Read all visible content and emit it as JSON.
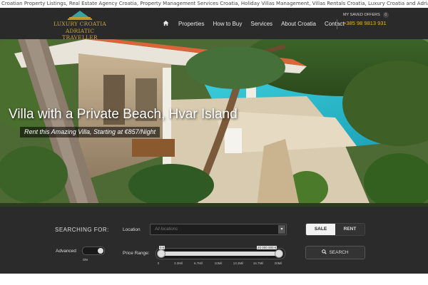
{
  "seo_text": "Croatian Property Listings, Real Estate Agency Croatia, Property Management Services Croatia, Holiday Villas Management, Villas Rentals Croatia, Luxury Croatia and Adriatic Traveller,",
  "logo": {
    "line1": "LUXURY CROATIA",
    "line2": "ADRIATIC TRAVELLER"
  },
  "nav": {
    "home_icon": "home-icon",
    "items": [
      {
        "label": "Properties"
      },
      {
        "label": "How to Buy"
      },
      {
        "label": "Services"
      },
      {
        "label": "About Croatia"
      },
      {
        "label": "Contact"
      }
    ]
  },
  "header_right": {
    "saved_label": "MY SAVED OFFERS",
    "saved_count": "0",
    "phone": "+385 98 9813 931"
  },
  "hero": {
    "title": "Villa with a Private Beach, Hvar Island",
    "subtitle": "Rent this Amazing Villa, Starting at €857/Night"
  },
  "search": {
    "heading": "SEARCHING FOR:",
    "advanced_label": "Advanced",
    "advanced_state": "ON",
    "location_label": "Location",
    "location_value": "All locations",
    "price_label": "Price Range:",
    "price_min": "0 €",
    "price_max": "20 000 000 €",
    "ticks": [
      "0",
      "3.3Mil",
      "6.7Mil",
      "10Mil",
      "13.3Mil",
      "16.7Mil",
      "20Mil"
    ],
    "sale_label": "SALE",
    "rent_label": "RENT",
    "active_mode": "SALE",
    "search_button": "SEARCH"
  },
  "colors": {
    "accent": "#e8b227",
    "header_bg": "#2a2a2a",
    "panel_bg": "#2b2b2b"
  }
}
